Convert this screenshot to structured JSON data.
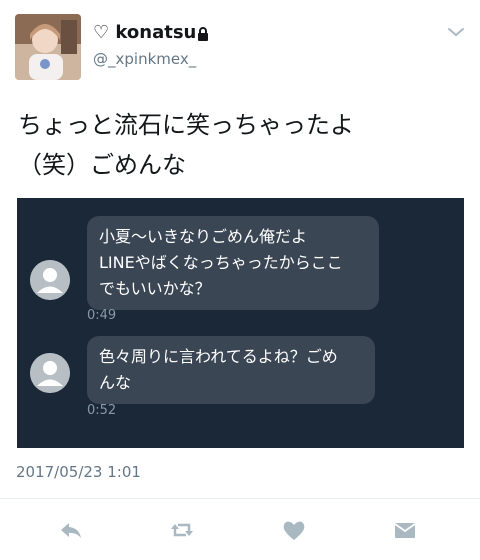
{
  "header": {
    "display_name": "♡ konatsu.",
    "handle": "@_xpinkmex_"
  },
  "tweet": {
    "lines": [
      "ちょっと流石に笑っちゃったよ",
      "（笑）ごめんな"
    ],
    "timestamp": "2017/05/23 1:01"
  },
  "media": {
    "messages": [
      {
        "lines": [
          "小夏〜いきなりごめん俺だよ",
          "LINEやばくなっちゃったからここ",
          "でもいいかな？"
        ],
        "time": "0:49"
      },
      {
        "lines": [
          "色々周りに言われてるよね？ごめ",
          "んな"
        ],
        "time": "0:52"
      }
    ]
  },
  "actions": {
    "icons": [
      "reply-icon",
      "retweet-icon",
      "like-icon",
      "message-icon"
    ]
  },
  "colors": {
    "media_bg": "#1b2838",
    "bubble_bg": "#3b4654",
    "secondary_text": "#657786",
    "icon_gray": "#aab8c2"
  }
}
